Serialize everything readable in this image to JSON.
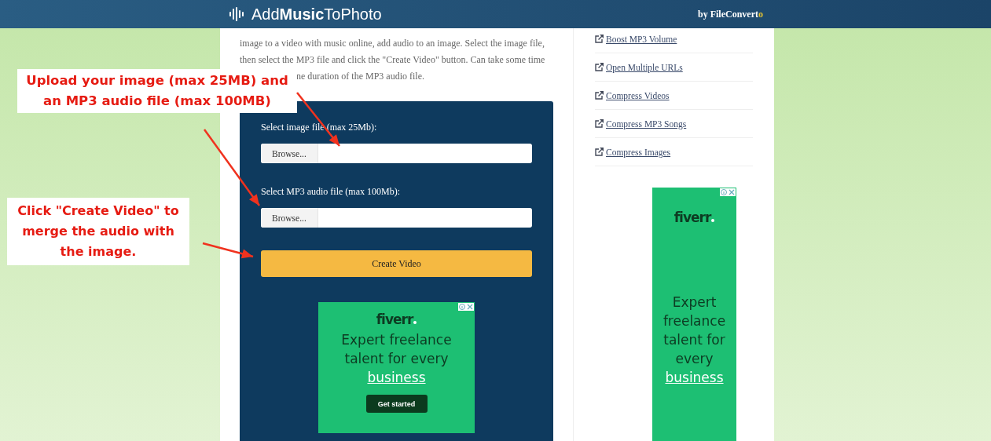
{
  "header": {
    "logo": "Add**Music**ToPhoto",
    "byline": "by FileConvert",
    "byline_accent": "o"
  },
  "intro_lines": [
    "image to a video with music online, add audio to an image. Select the image file,",
    "then select the MP3 file and click the \"Create Video\" button. Can take some time",
    "ne duration of the MP3 audio file."
  ],
  "form": {
    "fields": [
      {
        "label": "Select image file (max 25Mb):",
        "button": "Browse..."
      },
      {
        "label": "Select MP3 audio file (max 100Mb):",
        "button": "Browse..."
      }
    ],
    "submit": "Create Video"
  },
  "main_ad": {
    "brand": "fiverr",
    "headline": "Expert freelance talent for every",
    "link": "business",
    "cta": "Get started"
  },
  "sidebar_links": [
    "Boost MP3 Volume",
    "Open Multiple URLs",
    "Compress Videos",
    "Compress MP3 Songs",
    "Compress Images"
  ],
  "side_ad": {
    "brand": "fiverr",
    "headline": "Expert freelance talent for every",
    "link": "business"
  },
  "callouts": [
    "Upload your image (max 25MB) and an MP3 audio file (max 100MB)",
    "Click \"Create Video\" to merge the audio with the image."
  ]
}
